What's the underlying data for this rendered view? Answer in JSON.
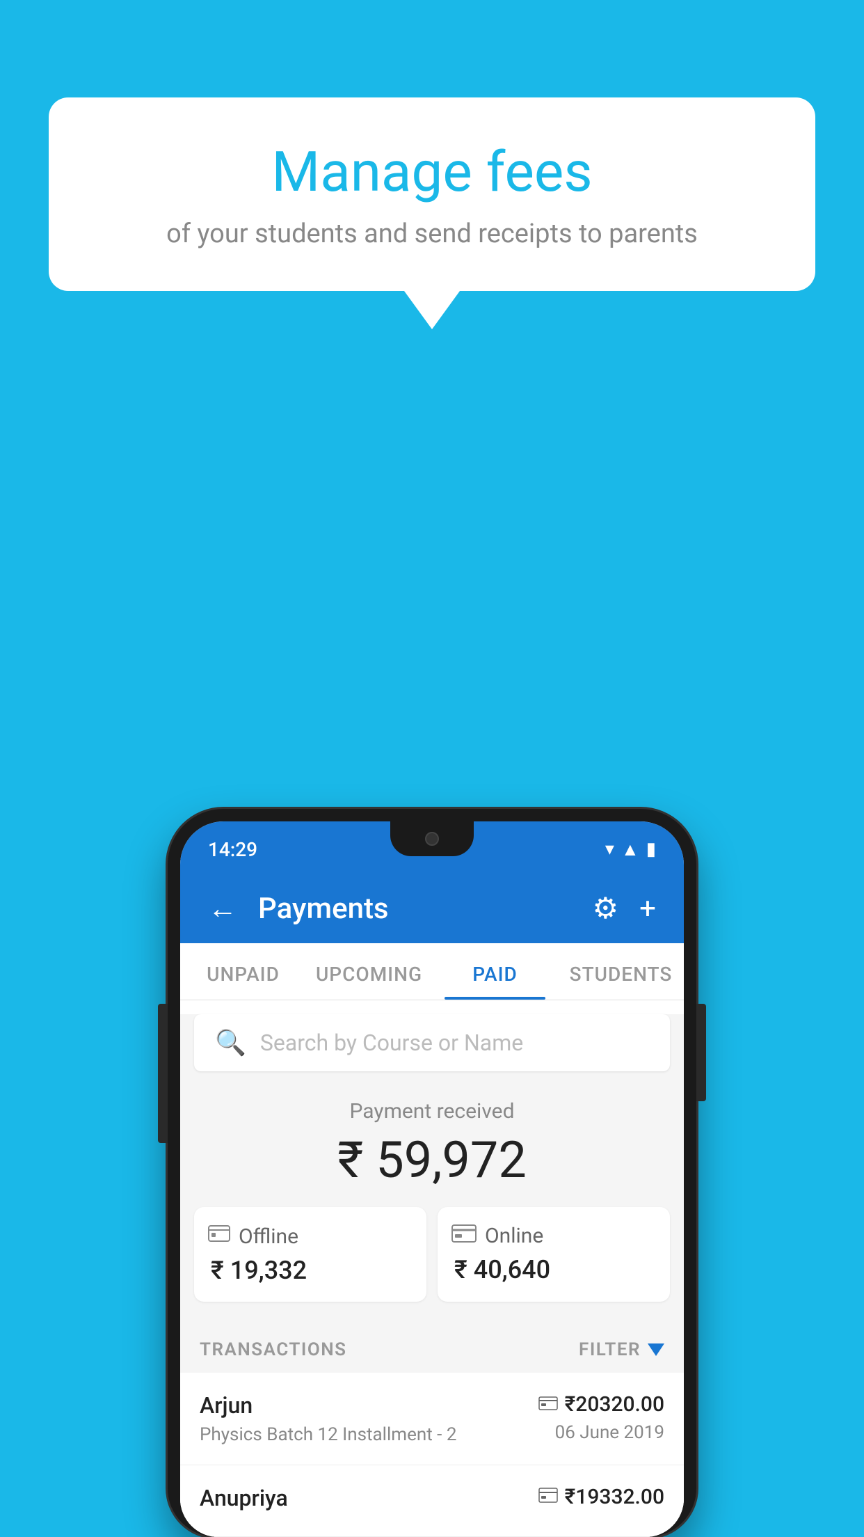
{
  "background_color": "#1ab8e8",
  "speech_bubble": {
    "title": "Manage fees",
    "subtitle": "of your students and send receipts to parents"
  },
  "phone": {
    "status_bar": {
      "time": "14:29",
      "icons": [
        "wifi",
        "signal",
        "battery"
      ]
    },
    "header": {
      "back_label": "←",
      "title": "Payments",
      "gear_label": "⚙",
      "plus_label": "+"
    },
    "tabs": [
      {
        "label": "UNPAID",
        "active": false
      },
      {
        "label": "UPCOMING",
        "active": false
      },
      {
        "label": "PAID",
        "active": true
      },
      {
        "label": "STUDENTS",
        "active": false
      }
    ],
    "search": {
      "placeholder": "Search by Course or Name"
    },
    "payment_summary": {
      "label": "Payment received",
      "amount": "₹ 59,972",
      "offline": {
        "label": "Offline",
        "amount": "₹ 19,332"
      },
      "online": {
        "label": "Online",
        "amount": "₹ 40,640"
      }
    },
    "transactions_section": {
      "label": "TRANSACTIONS",
      "filter_label": "FILTER"
    },
    "transactions": [
      {
        "name": "Arjun",
        "detail": "Physics Batch 12 Installment - 2",
        "amount": "₹20320.00",
        "date": "06 June 2019",
        "payment_type": "card"
      },
      {
        "name": "Anupriya",
        "detail": "",
        "amount": "₹19332.00",
        "date": "",
        "payment_type": "cash"
      }
    ]
  }
}
